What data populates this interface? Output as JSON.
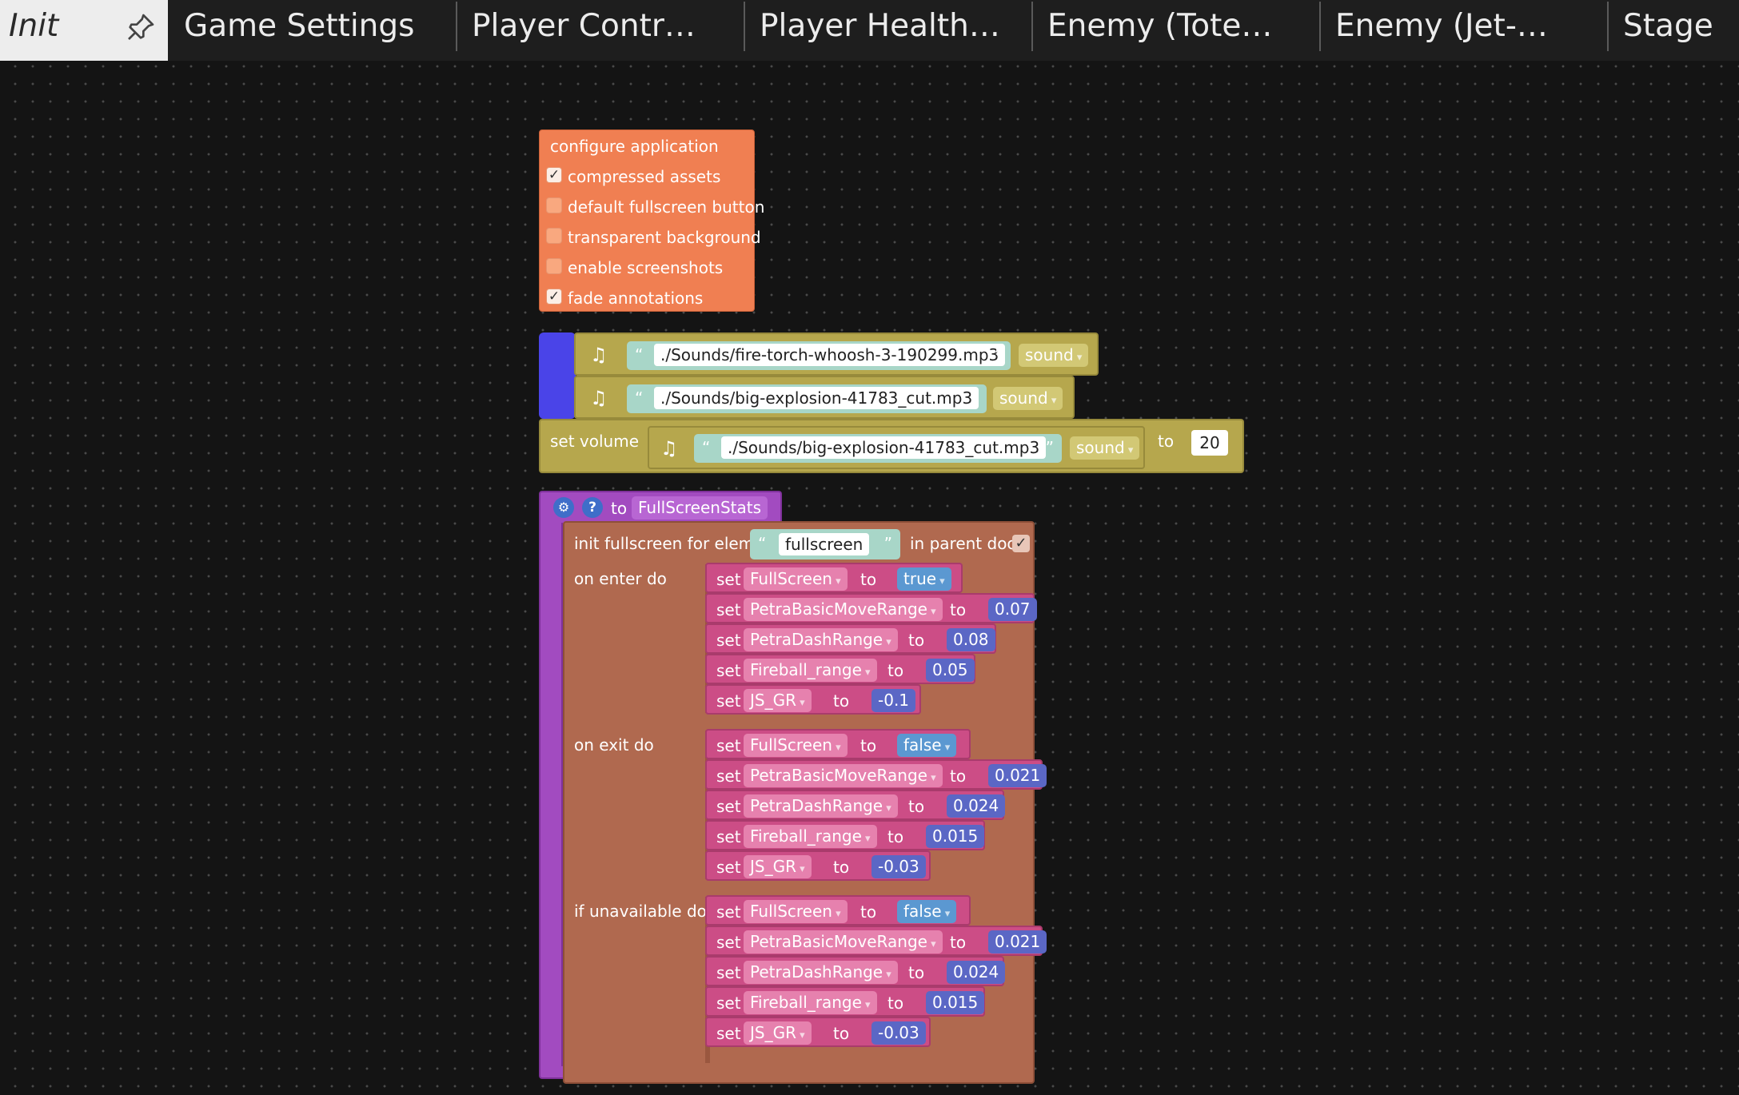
{
  "tabs": [
    {
      "label": "Init"
    },
    {
      "label": "Game Settings"
    },
    {
      "label": "Player Contr…"
    },
    {
      "label": "Player Health…"
    },
    {
      "label": "Enemy (Tote…"
    },
    {
      "label": "Enemy (Jet-…"
    },
    {
      "label": "Stage"
    }
  ],
  "config": {
    "title": "configure application",
    "options": [
      {
        "label": "compressed assets",
        "checked": true
      },
      {
        "label": "default fullscreen button",
        "checked": false
      },
      {
        "label": "transparent background",
        "checked": false
      },
      {
        "label": "enable screenshots",
        "checked": false
      },
      {
        "label": "fade annotations",
        "checked": true
      }
    ]
  },
  "sounds": [
    {
      "path": "./Sounds/fire-torch-whoosh-3-190299.mp3",
      "kind": "sound"
    },
    {
      "path": "./Sounds/big-explosion-41783_cut.mp3",
      "kind": "sound"
    }
  ],
  "volume": {
    "label": "set volume",
    "path": "./Sounds/big-explosion-41783_cut.mp3",
    "kind": "sound",
    "to": "to",
    "value": "20"
  },
  "func": {
    "to_label": "to",
    "name": "FullScreenStats",
    "init_label": "init fullscreen for elem",
    "elem": "fullscreen",
    "parent_label": "in parent doc",
    "parent_checked": true,
    "set_label": "set",
    "to_word": "to",
    "sections": [
      {
        "label": "on enter do",
        "rows": [
          {
            "var": "FullScreen",
            "value": "true",
            "type": "bool"
          },
          {
            "var": "PetraBasicMoveRange",
            "value": "0.07",
            "type": "num"
          },
          {
            "var": "PetraDashRange",
            "value": "0.08",
            "type": "num"
          },
          {
            "var": "Fireball_range",
            "value": "0.05",
            "type": "num"
          },
          {
            "var": "JS_GR",
            "value": "-0.1",
            "type": "num"
          }
        ]
      },
      {
        "label": "on exit do",
        "rows": [
          {
            "var": "FullScreen",
            "value": "false",
            "type": "bool"
          },
          {
            "var": "PetraBasicMoveRange",
            "value": "0.021",
            "type": "num"
          },
          {
            "var": "PetraDashRange",
            "value": "0.024",
            "type": "num"
          },
          {
            "var": "Fireball_range",
            "value": "0.015",
            "type": "num"
          },
          {
            "var": "JS_GR",
            "value": "-0.03",
            "type": "num"
          }
        ]
      },
      {
        "label": "if unavailable do",
        "rows": [
          {
            "var": "FullScreen",
            "value": "false",
            "type": "bool"
          },
          {
            "var": "PetraBasicMoveRange",
            "value": "0.021",
            "type": "num"
          },
          {
            "var": "PetraDashRange",
            "value": "0.024",
            "type": "num"
          },
          {
            "var": "Fireball_range",
            "value": "0.015",
            "type": "num"
          },
          {
            "var": "JS_GR",
            "value": "-0.03",
            "type": "num"
          }
        ]
      }
    ]
  }
}
